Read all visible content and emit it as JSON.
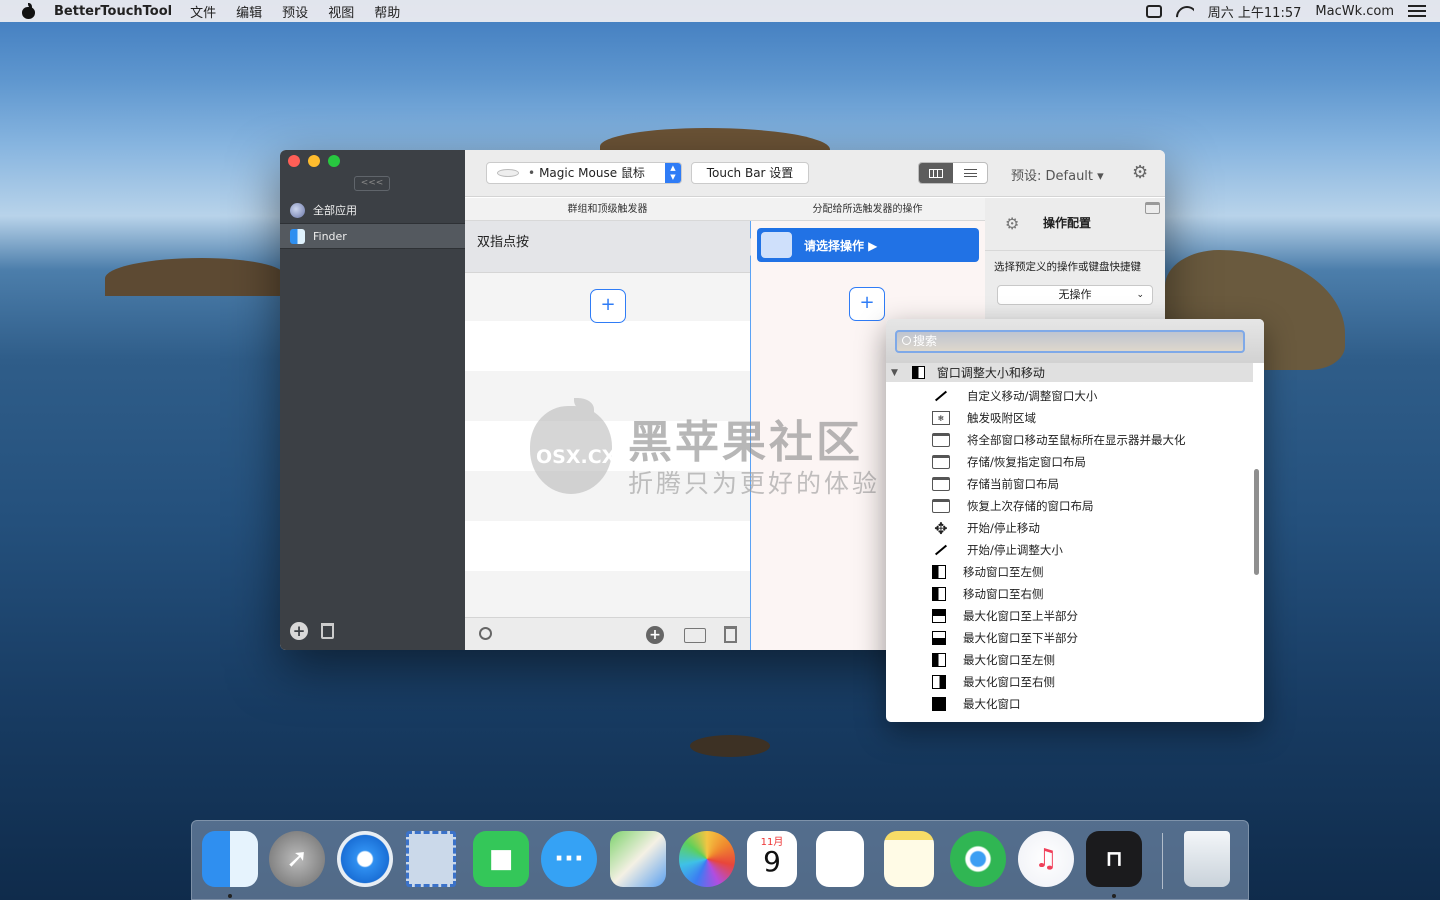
{
  "menubar": {
    "app_name": "BetterTouchTool",
    "items": [
      "文件",
      "编辑",
      "预设",
      "视图",
      "帮助"
    ],
    "clock": "周六 上午11:57",
    "site": "MacWk.com"
  },
  "sidebar": {
    "collapse_label": "<<<",
    "apps": [
      "全部应用",
      "Finder"
    ]
  },
  "toolbar": {
    "device": "Magic Mouse 鼠标",
    "touchbar_label": "Touch Bar 设置",
    "preset_label": "预设: Default"
  },
  "columns": {
    "triggers_header": "群组和顶级触发器",
    "actions_header": "分配给所选触发器的操作",
    "trigger_name": "双指点按",
    "action_pill": "请选择操作 ▶",
    "plus": "+"
  },
  "config": {
    "title": "操作配置",
    "description": "选择预定义的操作或键盘快捷键",
    "select_value": "无操作"
  },
  "dropdown": {
    "search_placeholder": "搜索",
    "category": "窗口调整大小和移动",
    "items": [
      {
        "label": "自定义移动/调整窗口大小",
        "icon": "resize-arrow-icon"
      },
      {
        "label": "触发吸附区域",
        "icon": "snap-area-icon"
      },
      {
        "label": "将全部窗口移动至鼠标所在显示器并最大化",
        "icon": "window-icon"
      },
      {
        "label": "存储/恢复指定窗口布局",
        "icon": "window-icon"
      },
      {
        "label": "存储当前窗口布局",
        "icon": "window-icon"
      },
      {
        "label": "恢复上次存储的窗口布局",
        "icon": "window-icon"
      },
      {
        "label": "开始/停止移动",
        "icon": "move-icon"
      },
      {
        "label": "开始/停止调整大小",
        "icon": "resize-arrow-icon"
      },
      {
        "label": "移动窗口至左侧",
        "icon": "half-left-icon"
      },
      {
        "label": "移动窗口至右侧",
        "icon": "half-left-icon"
      },
      {
        "label": "最大化窗口至上半部分",
        "icon": "half-top-icon"
      },
      {
        "label": "最大化窗口至下半部分",
        "icon": "half-bottom-icon"
      },
      {
        "label": "最大化窗口至左侧",
        "icon": "half-left-icon"
      },
      {
        "label": "最大化窗口至右侧",
        "icon": "half-right-icon"
      },
      {
        "label": "最大化窗口",
        "icon": "full-window-icon"
      }
    ]
  },
  "watermark": {
    "logo_text": "OSX.CX",
    "title": "黑苹果社区",
    "slogan": "折腾只为更好的体验"
  },
  "dock": {
    "calendar_month": "11月",
    "calendar_day": "9"
  }
}
